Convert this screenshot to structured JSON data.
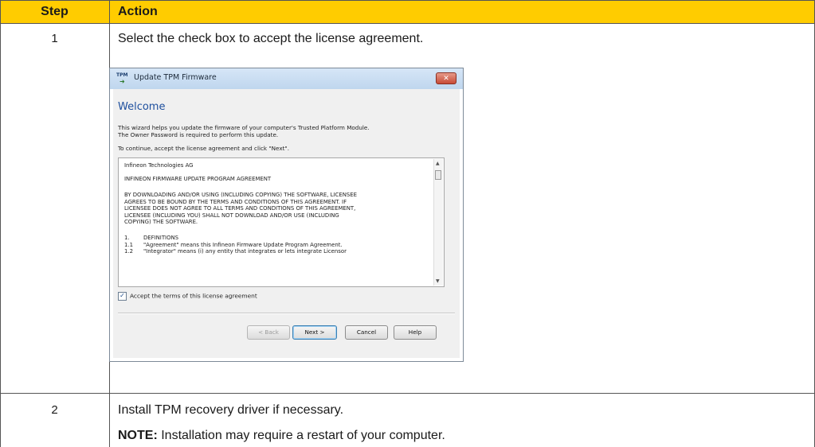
{
  "table": {
    "header": {
      "step": "Step",
      "action": "Action"
    },
    "rows": [
      {
        "step": "1",
        "action": "Select the check box to accept the license agreement."
      },
      {
        "step": "2",
        "action": "Install TPM recovery driver if necessary.",
        "note_label": "NOTE:",
        "note_text": " Installation may require a restart of your computer."
      }
    ]
  },
  "colors": {
    "header_bg": "#ffcc00",
    "welcome": "#1e4f9e",
    "close_button": "#c74b36"
  },
  "dialog": {
    "title_icon": "TPM",
    "title": "Update TPM Firmware",
    "close_glyph": "✕",
    "heading": "Welcome",
    "intro_line1": "This wizard helps you update the firmware of your computer's Trusted Platform Module.",
    "intro_line2": "The Owner Password is required to perform this update.",
    "intro_line3": "To continue, accept the license agreement and click \"Next\".",
    "license_lines": [
      "Infineon Technologies AG",
      "INFINEON FIRMWARE UPDATE PROGRAM AGREEMENT",
      "BY DOWNLOADING AND/OR USING (INCLUDING COPYING) THE SOFTWARE, LICENSEE",
      "AGREES TO BE BOUND BY THE TERMS AND CONDITIONS OF THIS AGREEMENT. IF",
      "LICENSEE DOES NOT AGREE TO ALL TERMS AND CONDITIONS OF THIS AGREEMENT,",
      "LICENSEE (INCLUDING YOU) SHALL NOT DOWNLOAD AND/OR USE (INCLUDING",
      "COPYING) THE SOFTWARE."
    ],
    "definitions": [
      {
        "num": "1.",
        "text": "DEFINITIONS"
      },
      {
        "num": "1.1",
        "text": "\"Agreement\" means this Infineon Firmware Update Program Agreement."
      },
      {
        "num": "1.2",
        "text": "\"Integrator\" means (i) any entity that integrates or lets integrate Licensor"
      }
    ],
    "accept_checked": true,
    "accept_mark": "✓",
    "accept_label": "Accept the terms of this license agreement",
    "buttons": {
      "back": "< Back",
      "next": "Next >",
      "cancel": "Cancel",
      "help": "Help"
    },
    "scroll_up": "▲",
    "scroll_down": "▼"
  }
}
